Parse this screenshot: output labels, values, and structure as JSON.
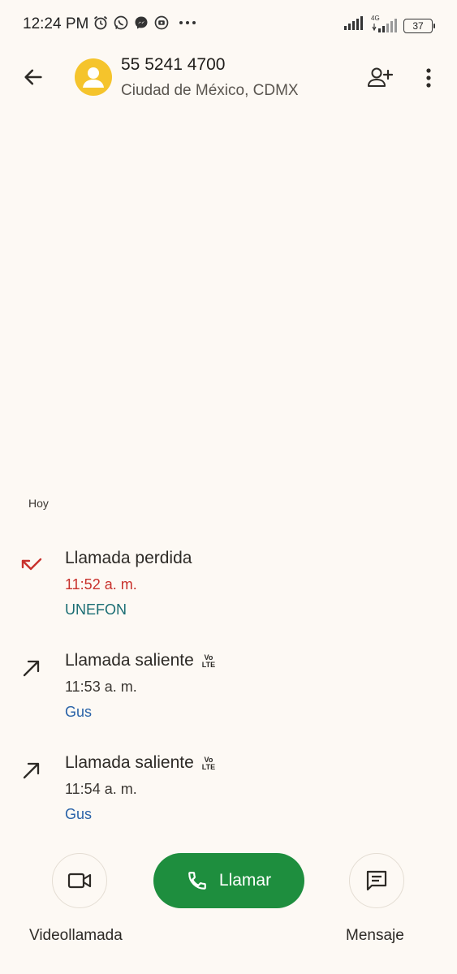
{
  "status_bar": {
    "time": "12:24 PM",
    "left_icons": [
      "alarm-icon",
      "whatsapp-icon",
      "messenger-icon",
      "app-notification-icon",
      "more-notifications-icon"
    ],
    "network_label": "4G",
    "battery_level": "37"
  },
  "header": {
    "number": "55 5241 4700",
    "location": "Ciudad de México, CDMX"
  },
  "history": {
    "section_label": "Hoy",
    "calls": [
      {
        "type": "missed",
        "title": "Llamada perdida",
        "time": "11:52 a. m.",
        "carrier": "UNEFON",
        "volte": false
      },
      {
        "type": "outgoing",
        "title": "Llamada saliente",
        "time": "11:53 a. m.",
        "carrier": "Gus",
        "volte": true
      },
      {
        "type": "outgoing",
        "title": "Llamada saliente",
        "time": "11:54 a. m.",
        "carrier": "Gus",
        "volte": true
      }
    ]
  },
  "volte_badge": {
    "top": "Vo",
    "bottom": "LTE"
  },
  "actions": {
    "video_label": "Videollamada",
    "call_label": "Llamar",
    "message_label": "Mensaje"
  },
  "colors": {
    "background": "#fdf9f4",
    "call_button": "#1e8e3e",
    "missed": "#c8312c",
    "avatar": "#f5c42c",
    "carrier_teal": "#1a6d73",
    "carrier_blue": "#2a63a8"
  }
}
